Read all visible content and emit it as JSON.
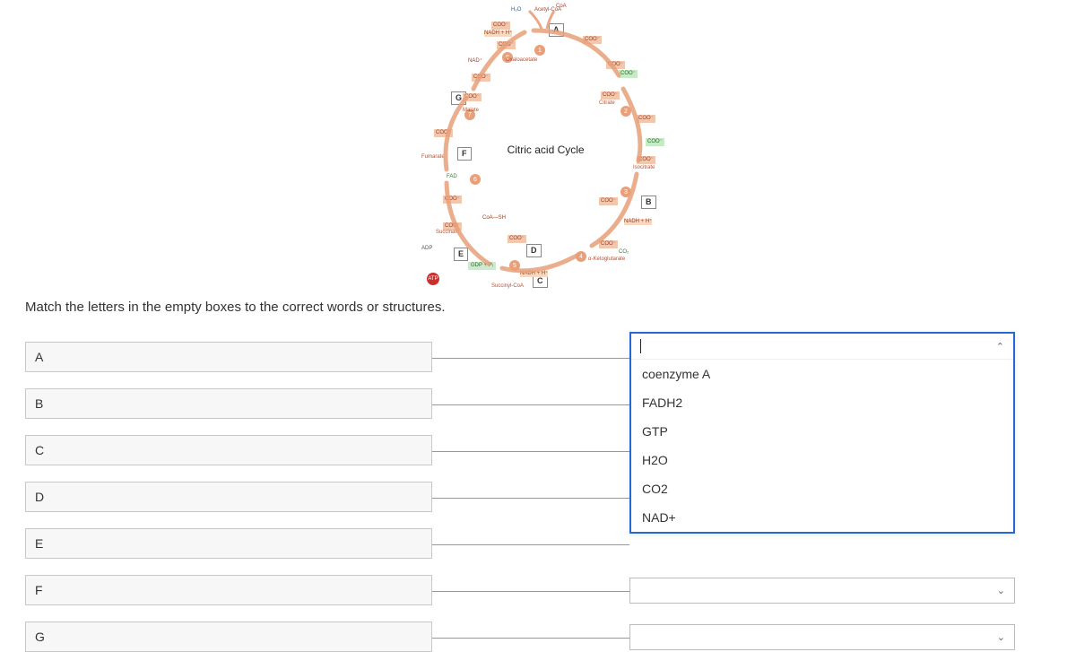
{
  "diagram": {
    "center_label": "Citric acid Cycle",
    "boxes": {
      "a": "A",
      "b": "B",
      "c": "C",
      "d": "D",
      "e": "E",
      "f": "F",
      "g": "G"
    },
    "top_inputs": {
      "h2o": "H₂O",
      "acetyl": "Acetyl-CoA",
      "coa": "CoA"
    },
    "labels": {
      "oxaloacetate": "Oxaloacetate",
      "citrate": "Citrate",
      "isocitrate": "Isocitrate",
      "aketoglutarate": "α-Ketoglutarate",
      "succinylcoa": "Succinyl-CoA",
      "succinate": "Succinate",
      "fumarate": "Fumarate",
      "malate": "Malate",
      "coash": "CoA—SH",
      "nadh": "NADH + H⁺",
      "nad": "NAD⁺",
      "fad": "FAD",
      "gdp": "GDP + Pᵢ",
      "atp": "ATP",
      "adp": "ADP",
      "co2": "CO₂",
      "coo": "COO⁻"
    },
    "steps": {
      "1": "1",
      "2": "2",
      "3": "3",
      "4": "4",
      "5": "5",
      "6": "6",
      "7": "7",
      "8": "8"
    }
  },
  "instruction": "Match the letters in the empty boxes to the correct words or structures.",
  "labels": {
    "a": "A",
    "b": "B",
    "c": "C",
    "d": "D",
    "e": "E",
    "f": "F",
    "g": "G"
  },
  "dropdown": {
    "options": [
      "coenzyme A",
      "FADH2",
      "GTP",
      "H2O",
      "CO2",
      "NAD+"
    ]
  }
}
